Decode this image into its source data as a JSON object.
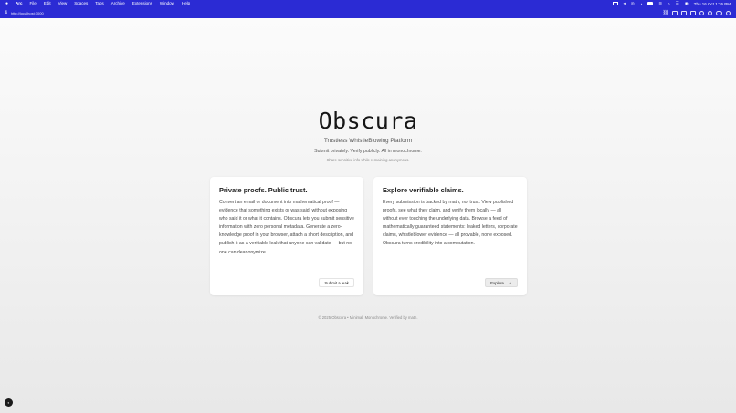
{
  "menubar": {
    "items": [
      "Arc",
      "File",
      "Edit",
      "View",
      "Spaces",
      "Tabs",
      "Archive",
      "Extensions",
      "Window",
      "Help"
    ],
    "datetime": "Thu 16 Oct  1:26 PM"
  },
  "toolbar": {
    "url": "http://localhost:3000"
  },
  "hero": {
    "title": "Obscura",
    "subtitle": "Trustless WhistleBlowing Platform",
    "tagline": "Submit privately. Verify publicly. All in monochrome.",
    "small": "Share sensitive info while remaining anonymous."
  },
  "cards": [
    {
      "title": "Private proofs. Public trust.",
      "body": "Convert an email or document into mathematical proof — evidence that something exists or was said, without exposing who said it or what it contains. Obscura lets you submit sensitive information with zero personal metadata. Generate a zero-knowledge proof in your browser, attach a short description, and publish it as a verifiable leak that anyone can validate — but no one can deanonymize.",
      "button": "Submit a leak"
    },
    {
      "title": "Explore verifiable claims.",
      "body": "Every submission is backed by math, not trust. View published proofs, see what they claim, and verify them locally — all without ever touching the underlying data. Browse a feed of mathematically guaranteed statements: leaked letters, corporate claims, whistleblower evidence — all provable, none exposed. Obscura turns credibility into a computation.",
      "button": "Explore",
      "button_arrow": "→"
    }
  ],
  "footer": "© 2025 Obscura • Minimal. Monochrome. Verified by math."
}
